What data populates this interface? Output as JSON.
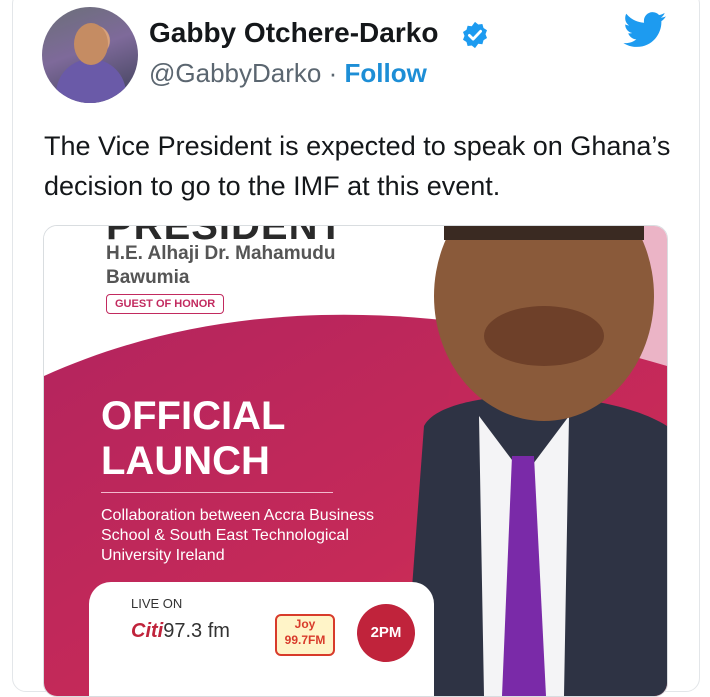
{
  "tweet": {
    "author_name": "Gabby Otchere-Darko",
    "handle": "@GabbyDarko",
    "separator": "·",
    "follow_label": "Follow",
    "text": "The Vice President is expected to speak on Ghana’s decision to go to the IMF at this event."
  },
  "flyer": {
    "top_heading_cut": "PRESIDENT",
    "vp_name": "H.E. Alhaji Dr. Mahamudu Bawumia",
    "badge": "GUEST OF HONOR",
    "headline": "OFFICIAL LAUNCH",
    "collaboration": "Collaboration between Accra Business School & South East Technological University Ireland",
    "live_on": "LIVE ON",
    "station1_brand": "Citi",
    "station1_freq": "97.3 fm",
    "station2": "Joy 99.7FM",
    "time": "2PM"
  },
  "colors": {
    "accent_blue": "#1d8ed6",
    "flyer_magenta": "#c22a5f"
  },
  "icons": {
    "verified": "verified-badge-icon",
    "twitter": "twitter-bird-icon"
  }
}
